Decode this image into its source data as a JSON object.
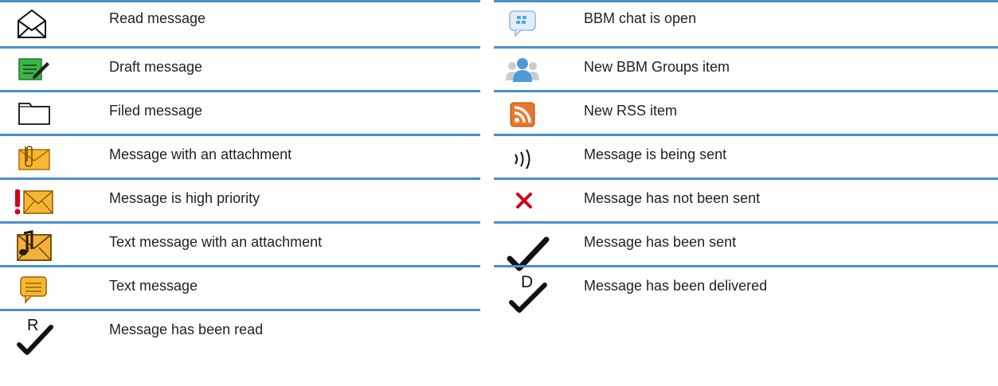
{
  "left_rows": [
    {
      "icon": "open-envelope-icon",
      "label": "Read message"
    },
    {
      "icon": "draft-message-icon",
      "label": "Draft message"
    },
    {
      "icon": "folder-icon",
      "label": "Filed message"
    },
    {
      "icon": "envelope-attachment-icon",
      "label": "Message with an attachment"
    },
    {
      "icon": "high-priority-envelope-icon",
      "label": "Message is high priority"
    },
    {
      "icon": "text-attachment-envelope-icon",
      "label": "Text message with an attachment"
    },
    {
      "icon": "text-message-bubble-icon",
      "label": "Text message"
    },
    {
      "icon": "read-checkmark-icon",
      "label": "Message has been read",
      "glyph": "R"
    }
  ],
  "right_rows": [
    {
      "icon": "bbm-chat-bubble-icon",
      "label": "BBM chat is open"
    },
    {
      "icon": "bbm-groups-people-icon",
      "label": "New BBM Groups item"
    },
    {
      "icon": "rss-feed-icon",
      "label": "New RSS item"
    },
    {
      "icon": "sending-waves-icon",
      "label": "Message is being sent"
    },
    {
      "icon": "not-sent-x-icon",
      "label": "Message has not been sent"
    },
    {
      "icon": "sent-checkmark-icon",
      "label": "Message has been sent"
    },
    {
      "icon": "delivered-checkmark-icon",
      "label": "Message has been delivered",
      "glyph": "D"
    }
  ],
  "colors": {
    "divider": "#4a90c8",
    "envelope_orange": "#f5a623",
    "draft_green": "#3cb54a",
    "error_red": "#d0021b",
    "rss_orange": "#e8772e",
    "bbm_blue": "#5aa0d8"
  }
}
